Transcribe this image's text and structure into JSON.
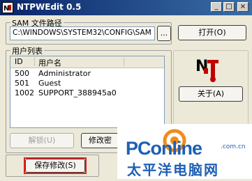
{
  "window": {
    "title": "NTPWEdit 0.5",
    "controls": [
      "_",
      "□",
      "×"
    ]
  },
  "sam": {
    "group_label": "SAM 文件路径",
    "path": "C:\\WINDOWS\\SYSTEM32\\CONFIG\\SAM",
    "browse_label": "...",
    "open_label": "打开(O)"
  },
  "users": {
    "group_label": "用户列表",
    "columns": [
      "ID",
      "用户名"
    ],
    "rows": [
      {
        "id": "500",
        "name": "Administrator"
      },
      {
        "id": "501",
        "name": "Guest"
      },
      {
        "id": "1002",
        "name": "SUPPORT_388945a0"
      }
    ]
  },
  "side": {
    "about_label": "关于(A)"
  },
  "actions": {
    "unlock_label": "解锁(U)",
    "change_label": "修改密",
    "save_label": "保存修改(S)"
  },
  "watermark": {
    "text_main": "PConline",
    "text_domain": ".com.cn",
    "text_cn": "太平洋电脑网"
  }
}
